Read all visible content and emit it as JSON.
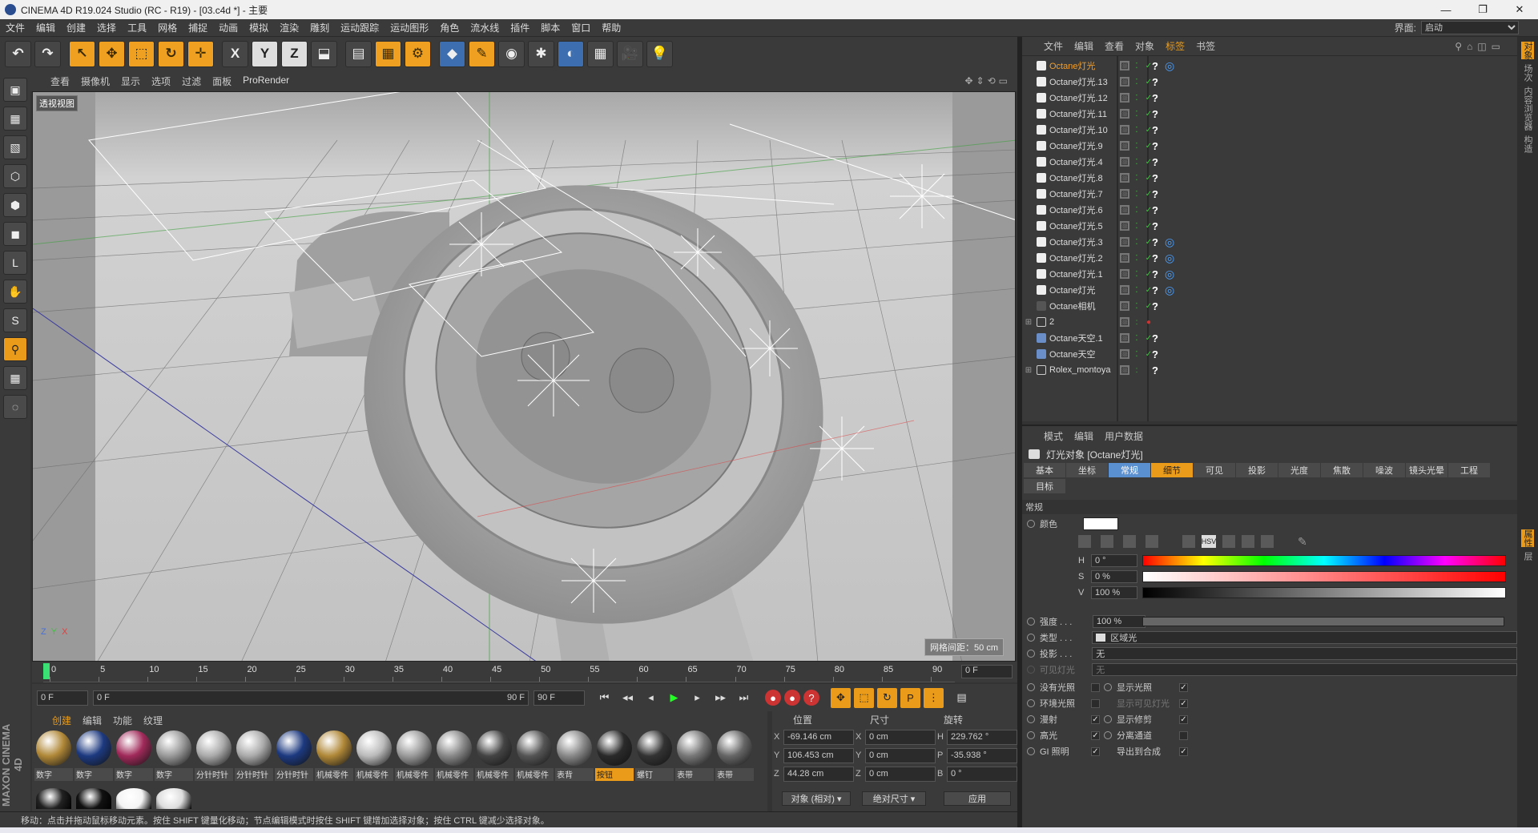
{
  "window": {
    "title": "CINEMA 4D R19.024 Studio (RC - R19) - [03.c4d *] - 主要",
    "controls": [
      "—",
      "❐",
      "✕"
    ]
  },
  "menu": {
    "items": [
      "文件",
      "编辑",
      "创建",
      "选择",
      "工具",
      "网格",
      "捕捉",
      "动画",
      "模拟",
      "渲染",
      "雕刻",
      "运动跟踪",
      "运动图形",
      "角色",
      "流水线",
      "插件",
      "脚本",
      "窗口",
      "帮助"
    ],
    "layout_label": "界面:",
    "layout_value": "启动"
  },
  "toolbar": {
    "items": [
      {
        "name": "undo-button",
        "glyph": "↶"
      },
      {
        "name": "redo-button",
        "glyph": "↷"
      },
      {
        "name": "select-tool-button",
        "glyph": "↖",
        "style": "orange"
      },
      {
        "name": "move-tool-button",
        "glyph": "✥",
        "style": "orange"
      },
      {
        "name": "scale-tool-button",
        "glyph": "⬚",
        "style": "orange"
      },
      {
        "name": "rotate-tool-button",
        "glyph": "↻",
        "style": "orange"
      },
      {
        "name": "transform-tool-button",
        "glyph": "✛",
        "style": "orange"
      },
      {
        "name": "x-axis-button",
        "glyph": "X"
      },
      {
        "name": "y-axis-button",
        "glyph": "Y",
        "style": "light"
      },
      {
        "name": "z-axis-button",
        "glyph": "Z",
        "style": "light"
      },
      {
        "name": "coord-system-button",
        "glyph": "⬓"
      },
      {
        "name": "render-view-button",
        "glyph": "▤"
      },
      {
        "name": "render-picture-viewer-button",
        "glyph": "▦",
        "style": "orange"
      },
      {
        "name": "render-settings-button",
        "glyph": "⚙",
        "style": "orange"
      },
      {
        "name": "cube-object-button",
        "glyph": "◆",
        "style": "blue"
      },
      {
        "name": "pen-spline-button",
        "glyph": "✎",
        "style": "orange"
      },
      {
        "name": "subdivision-button",
        "glyph": "◉"
      },
      {
        "name": "cloner-button",
        "glyph": "✱"
      },
      {
        "name": "deformer-button",
        "glyph": "◐",
        "style": "blue"
      },
      {
        "name": "floor-button",
        "glyph": "▦"
      },
      {
        "name": "camera-button",
        "glyph": "🎥"
      },
      {
        "name": "light-button",
        "glyph": "💡"
      }
    ]
  },
  "lefttools": [
    "cube-mode-icon",
    "texture-mode-icon",
    "workplane-icon",
    "points-mode-icon",
    "edges-mode-icon",
    "polygons-mode-icon",
    "axis-mode-icon",
    "tweak-icon",
    "snap-icon",
    "magnet-icon",
    "grid-lock-icon",
    "soft-select-icon"
  ],
  "viewport": {
    "menu": [
      "查看",
      "摄像机",
      "显示",
      "选项",
      "过滤",
      "面板",
      "ProRender"
    ],
    "label": "透视视图",
    "grid_label": "网格间距：50 cm",
    "axis": {
      "z": "Z",
      "y": "Y",
      "x": "X"
    }
  },
  "timeline": {
    "ticks": [
      "0",
      "5",
      "10",
      "15",
      "20",
      "25",
      "30",
      "35",
      "40",
      "45",
      "50",
      "55",
      "60",
      "65",
      "70",
      "75",
      "80",
      "85",
      "90"
    ],
    "current_frame": "0 F",
    "start": "0 F",
    "range_start": "0 F",
    "range_end": "90 F",
    "end": "90 F"
  },
  "playback_buttons": [
    "⏮",
    "◂◂",
    "◂",
    "▶",
    "▸",
    "▸▸",
    "⏭"
  ],
  "materials": {
    "menu": [
      "创建",
      "编辑",
      "功能",
      "纹理"
    ],
    "items": [
      {
        "label": "数字",
        "color": "#b08838"
      },
      {
        "label": "数字",
        "color": "#1d3a80"
      },
      {
        "label": "数字",
        "color": "#a02a5a"
      },
      {
        "label": "数字",
        "color": "#999999"
      },
      {
        "label": "分针时针",
        "color": "#aaaaaa"
      },
      {
        "label": "分针时针",
        "color": "#aaaaaa"
      },
      {
        "label": "分针时针",
        "color": "#1d3a80"
      },
      {
        "label": "机械零件",
        "color": "#b08838"
      },
      {
        "label": "机械零件",
        "color": "#bbbbbb"
      },
      {
        "label": "机械零件",
        "color": "#9a9a9a"
      },
      {
        "label": "机械零件",
        "color": "#888888"
      },
      {
        "label": "机械零件",
        "color": "#444444"
      },
      {
        "label": "机械零件",
        "color": "#555555"
      },
      {
        "label": "表背",
        "color": "#888888"
      },
      {
        "label": "按钮",
        "color": "#2a2a2a",
        "selected": true
      },
      {
        "label": "螺钉",
        "color": "#333333"
      },
      {
        "label": "表带",
        "color": "#777777"
      },
      {
        "label": "表带",
        "color": "#666666"
      }
    ],
    "row2_colors": [
      "#222222",
      "#111111",
      "#f4f4f4",
      "#dddddd"
    ]
  },
  "coords": {
    "headers": [
      "位置",
      "尺寸",
      "旋转"
    ],
    "rows": [
      {
        "axis": "X",
        "pos": "-69.146 cm",
        "size_axis": "X",
        "size": "0 cm",
        "rot_axis": "H",
        "rot": "229.762 °"
      },
      {
        "axis": "Y",
        "pos": "106.453 cm",
        "size_axis": "Y",
        "size": "0 cm",
        "rot_axis": "P",
        "rot": "-35.938 °"
      },
      {
        "axis": "Z",
        "pos": "44.28 cm",
        "size_axis": "Z",
        "size": "0 cm",
        "rot_axis": "B",
        "rot": "0 °"
      }
    ],
    "mode_select": "对象 (相对)",
    "size_select": "绝对尺寸",
    "apply": "应用"
  },
  "status": "移动：点击并拖动鼠标移动元素。按住 SHIFT 键量化移动；节点编辑模式时按住 SHIFT 键增加选择对象；按住 CTRL 键减少选择对象。",
  "maxon": "MAXON CINEMA 4D",
  "objects": {
    "menu": [
      "文件",
      "编辑",
      "查看",
      "对象",
      "标签",
      "书签"
    ],
    "rows": [
      {
        "name": "Octane灯光",
        "selected": true,
        "icon": "#eeeeee",
        "ring": true,
        "tree": ""
      },
      {
        "name": "Octane灯光.13",
        "icon": "#eeeeee",
        "tree": ""
      },
      {
        "name": "Octane灯光.12",
        "icon": "#eeeeee",
        "tree": ""
      },
      {
        "name": "Octane灯光.11",
        "icon": "#eeeeee",
        "tree": ""
      },
      {
        "name": "Octane灯光.10",
        "icon": "#eeeeee",
        "tree": ""
      },
      {
        "name": "Octane灯光.9",
        "icon": "#eeeeee",
        "tree": ""
      },
      {
        "name": "Octane灯光.4",
        "icon": "#eeeeee",
        "tree": ""
      },
      {
        "name": "Octane灯光.8",
        "icon": "#eeeeee",
        "tree": ""
      },
      {
        "name": "Octane灯光.7",
        "icon": "#eeeeee",
        "tree": ""
      },
      {
        "name": "Octane灯光.6",
        "icon": "#eeeeee",
        "tree": ""
      },
      {
        "name": "Octane灯光.5",
        "icon": "#eeeeee",
        "tree": ""
      },
      {
        "name": "Octane灯光.3",
        "icon": "#eeeeee",
        "ring": true,
        "tree": ""
      },
      {
        "name": "Octane灯光.2",
        "icon": "#eeeeee",
        "ring": true,
        "tree": ""
      },
      {
        "name": "Octane灯光.1",
        "icon": "#eeeeee",
        "ring": true,
        "tree": ""
      },
      {
        "name": "Octane灯光",
        "icon": "#eeeeee",
        "ring": true,
        "tree": ""
      },
      {
        "name": "Octane相机",
        "icon": "#555555",
        "tree": ""
      },
      {
        "name": "2",
        "icon": "#3a3a3a",
        "tree": "⊞",
        "nul": true
      },
      {
        "name": "Octane天空.1",
        "icon": "#6a8fc8",
        "tree": ""
      },
      {
        "name": "Octane天空",
        "icon": "#6a8fc8",
        "tree": ""
      },
      {
        "name": "Rolex_montoya",
        "icon": "#3a3a3a",
        "tree": "⊞",
        "nul": true
      }
    ]
  },
  "attributes": {
    "menu": [
      "模式",
      "编辑",
      "用户数据"
    ],
    "title": "灯光对象 [Octane灯光]",
    "tabs": [
      {
        "label": "基本"
      },
      {
        "label": "坐标"
      },
      {
        "label": "常规",
        "state": "sel"
      },
      {
        "label": "细节",
        "state": "sel2"
      },
      {
        "label": "可见"
      },
      {
        "label": "投影"
      },
      {
        "label": "光度"
      },
      {
        "label": "焦散"
      },
      {
        "label": "噪波"
      },
      {
        "label": "镜头光晕"
      },
      {
        "label": "工程"
      },
      {
        "label": "目标"
      }
    ],
    "section": "常规",
    "color_label": "颜色",
    "hsv": [
      {
        "label": "H",
        "value": "0 °"
      },
      {
        "label": "S",
        "value": "0 %"
      },
      {
        "label": "V",
        "value": "100 %"
      }
    ],
    "intensity_label": "强度 . . .",
    "intensity_value": "100 %",
    "type_label": "类型 . . .",
    "type_value": "区域光",
    "shadow_label": "投影 . . .",
    "shadow_value": "无",
    "visible_light_label": "可见灯光",
    "visible_light_value": "无",
    "checks_left": [
      {
        "label": "没有光照",
        "checked": false
      },
      {
        "label": "环境光照",
        "checked": false
      },
      {
        "label": "漫射",
        "checked": true
      },
      {
        "label": "高光",
        "checked": true
      },
      {
        "label": "GI 照明",
        "checked": true
      }
    ],
    "checks_right": [
      {
        "label": "显示光照",
        "checked": true,
        "dim": false
      },
      {
        "label": "显示可见灯光",
        "checked": true,
        "dim": true
      },
      {
        "label": "显示修剪",
        "checked": true,
        "dim": false
      },
      {
        "label": "分离通道",
        "checked": false,
        "dim": false
      },
      {
        "label": "导出到合成",
        "checked": true,
        "dim": false
      }
    ]
  },
  "side_tabs": [
    "对象",
    "场次",
    "内容浏览器",
    "构造",
    "属性",
    "层"
  ]
}
